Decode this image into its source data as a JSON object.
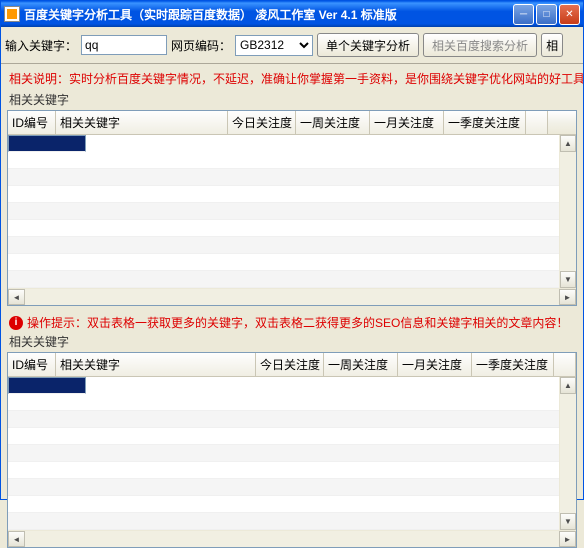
{
  "title": "百度关键字分析工具（实时跟踪百度数据）  凌风工作室  Ver 4.1 标准版",
  "toolbar": {
    "input_label": "输入关键字：",
    "keyword_value": "qq",
    "encoding_label": "网页编码：",
    "encoding_value": "GB2312",
    "btn_single": "单个关键字分析",
    "btn_related": "相关百度搜索分析",
    "btn_cut": "相"
  },
  "note1": "相关说明：实时分析百度关键字情况，不延迟，准确让你掌握第一手资料，是你围绕关键字优化网站的好工具",
  "group1_title": "相关关键字",
  "tip": "操作提示：双击表格一获取更多的关键字，双击表格二获得更多的SEO信息和关键字相关的文章内容！",
  "group2_title": "相关关键字",
  "columns": {
    "id": "ID编号",
    "kw": "相关关键字",
    "today": "今日关注度",
    "week": "一周关注度",
    "month": "一月关注度",
    "quarter": "一季度关注度"
  }
}
